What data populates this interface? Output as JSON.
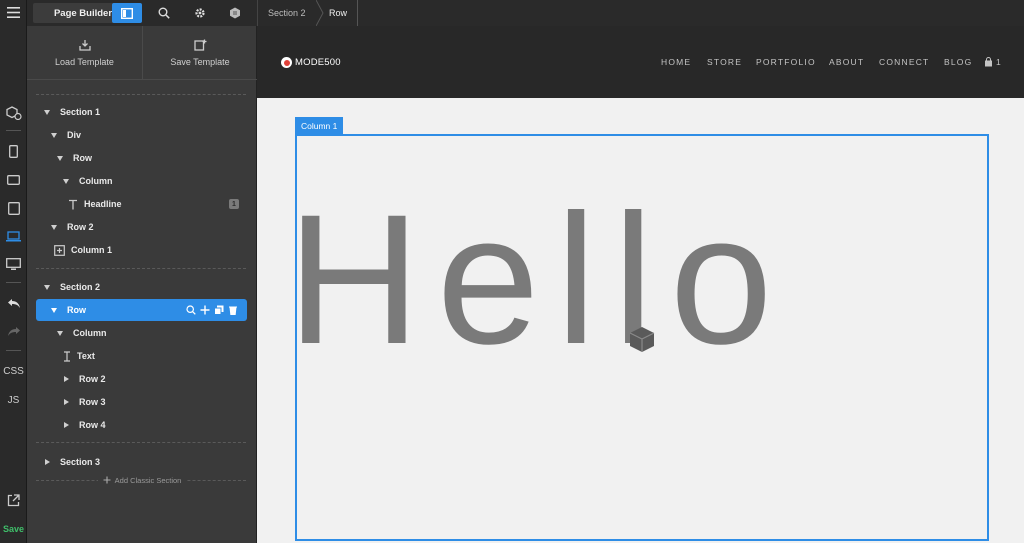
{
  "topbar": {
    "page_builder_label": "Page Builder",
    "icons": [
      "sidebar-toggle-icon",
      "search-icon",
      "gear-icon",
      "hexagon-icon"
    ]
  },
  "breadcrumbs": [
    "Section 2",
    "Row"
  ],
  "rail": {
    "icons": [
      "menu-icon",
      "cube-add-icon",
      "phone-icon",
      "tablet-landscape-icon",
      "tablet-icon",
      "laptop-icon",
      "desktop-icon",
      "undo-icon",
      "redo-icon"
    ],
    "css_label": "CSS",
    "js_label": "JS",
    "save_label": "Save"
  },
  "panel": {
    "load_template": "Load Template",
    "save_template": "Save Template",
    "tree": [
      {
        "label": "Section 1",
        "caret": "down"
      },
      {
        "label": "Div",
        "caret": "down"
      },
      {
        "label": "Row",
        "caret": "down"
      },
      {
        "label": "Column",
        "caret": "down"
      },
      {
        "label": "Headline",
        "icon": "text-icon",
        "badge": "1"
      },
      {
        "label": "Row 2",
        "caret": "down"
      },
      {
        "label": "Column 1",
        "icon": "plus-box-icon"
      },
      {
        "label": "Section 2",
        "caret": "down"
      },
      {
        "label": "Row",
        "caret": "down",
        "selected": true
      },
      {
        "label": "Column",
        "caret": "down"
      },
      {
        "label": "Text",
        "icon": "text-cursor-icon"
      },
      {
        "label": "Row 2",
        "caret": "right"
      },
      {
        "label": "Row 3",
        "caret": "right"
      },
      {
        "label": "Row 4",
        "caret": "right"
      },
      {
        "label": "Section 3",
        "caret": "right"
      }
    ],
    "add_classic_section": "Add Classic Section"
  },
  "site": {
    "logo_text": "MODE500",
    "nav": [
      "HOME",
      "STORE",
      "PORTFOLIO",
      "ABOUT",
      "CONNECT",
      "BLOG"
    ],
    "cart_count": "1",
    "column_tag": "Column 1",
    "headline": "Hello"
  },
  "colors": {
    "accent": "#2e8de6",
    "save": "#3fbf6a",
    "headline": "#7a7a7a",
    "logo_dot": "#e0413a"
  }
}
